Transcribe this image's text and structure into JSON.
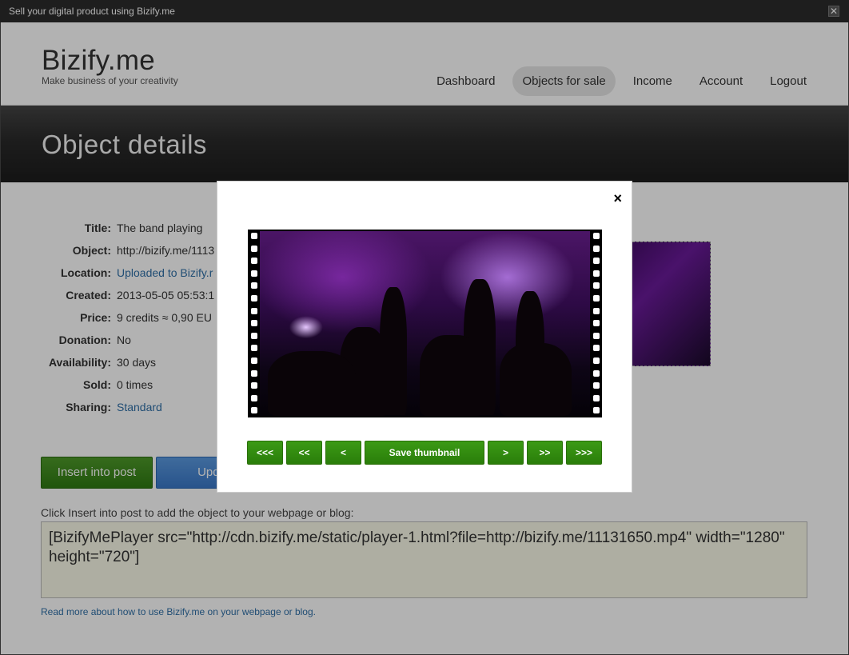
{
  "window": {
    "title": "Sell your digital product using Bizify.me",
    "close_glyph": "✕"
  },
  "header": {
    "logo": "Bizify.me",
    "tagline": "Make business of your creativity",
    "nav": [
      "Dashboard",
      "Objects for sale",
      "Income",
      "Account",
      "Logout"
    ],
    "active_nav": "Objects for sale"
  },
  "hero": {
    "title": "Object details"
  },
  "details": [
    {
      "label": "Title:",
      "value": "The band playing",
      "link": false
    },
    {
      "label": "Object:",
      "value": "http://bizify.me/1113",
      "link": false
    },
    {
      "label": "Location:",
      "value": "Uploaded to Bizify.r",
      "link": true
    },
    {
      "label": "Created:",
      "value": "2013-05-05 05:53:1",
      "link": false
    },
    {
      "label": "Price:",
      "value": "9 credits ≈ 0,90 EU",
      "link": false
    },
    {
      "label": "Donation:",
      "value": "No",
      "link": false
    },
    {
      "label": "Availability:",
      "value": "30 days",
      "link": false
    },
    {
      "label": "Sold:",
      "value": "0 times",
      "link": false
    },
    {
      "label": "Sharing:",
      "value": "Standard",
      "link": true
    }
  ],
  "actions": {
    "insert": "Insert into post",
    "update": "Upda"
  },
  "embed": {
    "instruction": "Click Insert into post to add the object to your webpage or blog:",
    "code": "[BizifyMePlayer src=\"http://cdn.bizify.me/static/player-1.html?file=http://bizify.me/11131650.mp4\" width=\"1280\" height=\"720\"]",
    "read_more": "Read more about how to use Bizify.me on your webpage or blog."
  },
  "modal": {
    "close_glyph": "×",
    "buttons": [
      "<<<",
      "<<",
      "<",
      "Save thumbnail",
      ">",
      ">>",
      ">>>"
    ]
  },
  "colors": {
    "accent_green": "#2f7a12",
    "accent_blue": "#3a78c8",
    "link": "#2f6fa7"
  }
}
